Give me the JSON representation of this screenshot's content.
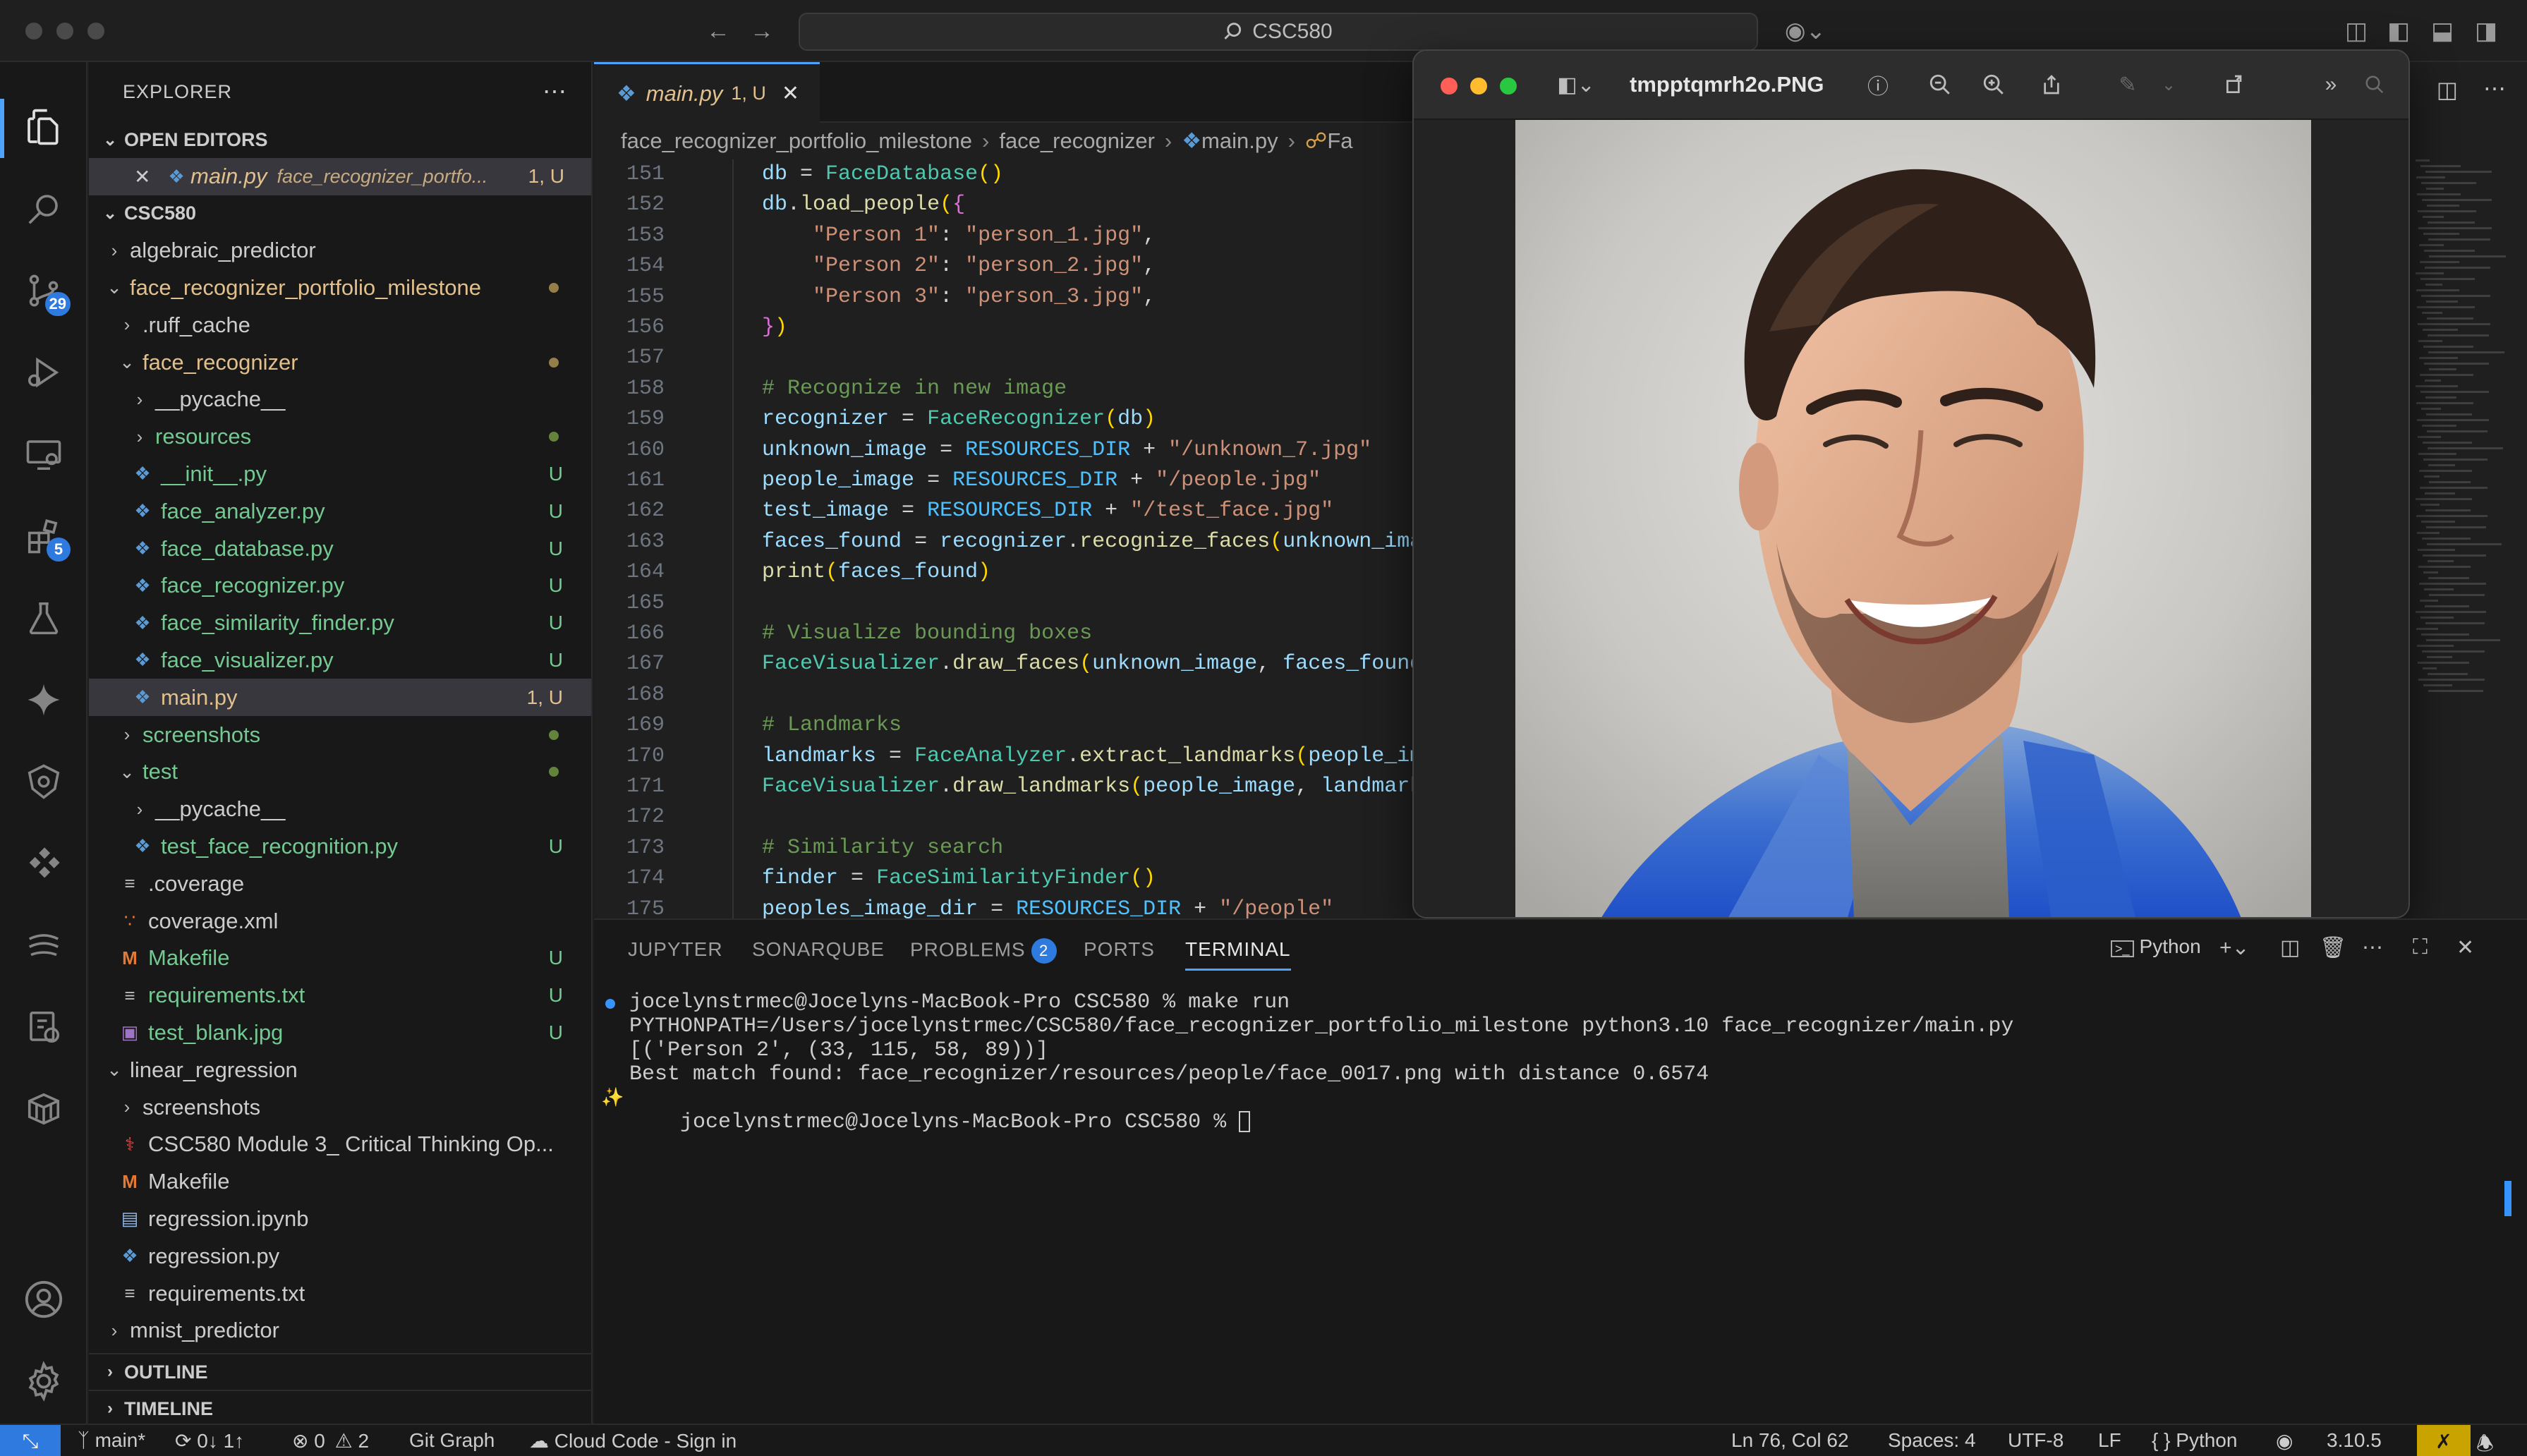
{
  "window": {
    "search_text": "CSC580"
  },
  "activity": {
    "source_control_badge": "29",
    "extensions_badge": "5"
  },
  "explorer": {
    "title": "EXPLORER",
    "open_editors_label": "OPEN EDITORS",
    "open_editor": {
      "name": "main.py",
      "path": "face_recognizer_portfo...",
      "status": "1, U"
    },
    "root_label": "CSC580",
    "tree": [
      {
        "name": "algebraic_predictor",
        "type": "folder",
        "open": false,
        "depth": 0,
        "color": "plain",
        "status": ""
      },
      {
        "name": "face_recognizer_portfolio_milestone",
        "type": "folder",
        "open": true,
        "depth": 0,
        "color": "mod",
        "status": "dot"
      },
      {
        "name": ".ruff_cache",
        "type": "folder",
        "open": false,
        "depth": 1,
        "color": "plain",
        "status": ""
      },
      {
        "name": "face_recognizer",
        "type": "folder",
        "open": true,
        "depth": 1,
        "color": "mod",
        "status": "dot"
      },
      {
        "name": "__pycache__",
        "type": "folder",
        "open": false,
        "depth": 2,
        "color": "plain",
        "status": ""
      },
      {
        "name": "resources",
        "type": "folder",
        "open": false,
        "depth": 2,
        "color": "new",
        "status": "dot"
      },
      {
        "name": "__init__.py",
        "type": "py",
        "depth": 2,
        "color": "new",
        "status": "U"
      },
      {
        "name": "face_analyzer.py",
        "type": "py",
        "depth": 2,
        "color": "new",
        "status": "U"
      },
      {
        "name": "face_database.py",
        "type": "py",
        "depth": 2,
        "color": "new",
        "status": "U"
      },
      {
        "name": "face_recognizer.py",
        "type": "py",
        "depth": 2,
        "color": "new",
        "status": "U"
      },
      {
        "name": "face_similarity_finder.py",
        "type": "py",
        "depth": 2,
        "color": "new",
        "status": "U"
      },
      {
        "name": "face_visualizer.py",
        "type": "py",
        "depth": 2,
        "color": "new",
        "status": "U"
      },
      {
        "name": "main.py",
        "type": "py",
        "depth": 2,
        "color": "mod",
        "status": "1, U",
        "selected": true
      },
      {
        "name": "screenshots",
        "type": "folder",
        "open": false,
        "depth": 1,
        "color": "new",
        "status": "dot"
      },
      {
        "name": "test",
        "type": "folder",
        "open": true,
        "depth": 1,
        "color": "new",
        "status": "dot"
      },
      {
        "name": "__pycache__",
        "type": "folder",
        "open": false,
        "depth": 2,
        "color": "plain",
        "status": ""
      },
      {
        "name": "test_face_recognition.py",
        "type": "py",
        "depth": 2,
        "color": "new",
        "status": "U"
      },
      {
        "name": ".coverage",
        "type": "txt",
        "depth": 1,
        "color": "plain",
        "status": ""
      },
      {
        "name": "coverage.xml",
        "type": "rss",
        "depth": 1,
        "color": "plain",
        "status": ""
      },
      {
        "name": "Makefile",
        "type": "mk",
        "depth": 1,
        "color": "new",
        "status": "U"
      },
      {
        "name": "requirements.txt",
        "type": "txt",
        "depth": 1,
        "color": "new",
        "status": "U"
      },
      {
        "name": "test_blank.jpg",
        "type": "img",
        "depth": 1,
        "color": "new",
        "status": "U"
      },
      {
        "name": "linear_regression",
        "type": "folder",
        "open": true,
        "depth": 0,
        "color": "plain",
        "status": ""
      },
      {
        "name": "screenshots",
        "type": "folder",
        "open": false,
        "depth": 1,
        "color": "plain",
        "status": ""
      },
      {
        "name": "CSC580 Module 3_ Critical Thinking Op...",
        "type": "pdf",
        "depth": 1,
        "color": "plain",
        "status": ""
      },
      {
        "name": "Makefile",
        "type": "mk",
        "depth": 1,
        "color": "plain",
        "status": ""
      },
      {
        "name": "regression.ipynb",
        "type": "nb",
        "depth": 1,
        "color": "plain",
        "status": ""
      },
      {
        "name": "regression.py",
        "type": "py",
        "depth": 1,
        "color": "plain",
        "status": ""
      },
      {
        "name": "requirements.txt",
        "type": "txt",
        "depth": 1,
        "color": "plain",
        "status": ""
      },
      {
        "name": "mnist_predictor",
        "type": "folder",
        "open": false,
        "depth": 0,
        "color": "plain",
        "status": ""
      }
    ],
    "outline_label": "OUTLINE",
    "timeline_label": "TIMELINE"
  },
  "editor": {
    "tab": {
      "name": "main.py",
      "status": "1, U"
    },
    "breadcrumb": [
      "face_recognizer_portfolio_milestone",
      "face_recognizer",
      "main.py",
      "Fa"
    ],
    "lines": [
      {
        "n": "151",
        "t": [
          [
            "    ",
            "op"
          ],
          [
            "db",
            "var"
          ],
          [
            " = ",
            "op"
          ],
          [
            "FaceDatabase",
            "cls"
          ],
          [
            "()",
            "br2"
          ]
        ]
      },
      {
        "n": "152",
        "t": [
          [
            "    ",
            "op"
          ],
          [
            "db",
            "var"
          ],
          [
            ".",
            "op"
          ],
          [
            "load_people",
            "fn"
          ],
          [
            "(",
            "br2"
          ],
          [
            "{",
            "br"
          ]
        ]
      },
      {
        "n": "153",
        "t": [
          [
            "        ",
            "op"
          ],
          [
            "\"Person 1\"",
            "str"
          ],
          [
            ": ",
            "op"
          ],
          [
            "\"person_1.jpg\"",
            "str"
          ],
          [
            ",",
            "op"
          ]
        ]
      },
      {
        "n": "154",
        "t": [
          [
            "        ",
            "op"
          ],
          [
            "\"Person 2\"",
            "str"
          ],
          [
            ": ",
            "op"
          ],
          [
            "\"person_2.jpg\"",
            "str"
          ],
          [
            ",",
            "op"
          ]
        ]
      },
      {
        "n": "155",
        "t": [
          [
            "        ",
            "op"
          ],
          [
            "\"Person 3\"",
            "str"
          ],
          [
            ": ",
            "op"
          ],
          [
            "\"person_3.jpg\"",
            "str"
          ],
          [
            ",",
            "op"
          ]
        ]
      },
      {
        "n": "156",
        "t": [
          [
            "    ",
            "op"
          ],
          [
            "}",
            "br"
          ],
          [
            ")",
            "br2"
          ]
        ]
      },
      {
        "n": "157",
        "t": []
      },
      {
        "n": "158",
        "t": [
          [
            "    ",
            "op"
          ],
          [
            "# Recognize in new image",
            "cm"
          ]
        ]
      },
      {
        "n": "159",
        "t": [
          [
            "    ",
            "op"
          ],
          [
            "recognizer",
            "var"
          ],
          [
            " = ",
            "op"
          ],
          [
            "FaceRecognizer",
            "cls"
          ],
          [
            "(",
            "br2"
          ],
          [
            "db",
            "var"
          ],
          [
            ")",
            "br2"
          ]
        ]
      },
      {
        "n": "160",
        "t": [
          [
            "    ",
            "op"
          ],
          [
            "unknown_image",
            "var"
          ],
          [
            " = ",
            "op"
          ],
          [
            "RESOURCES_DIR",
            "const"
          ],
          [
            " + ",
            "op"
          ],
          [
            "\"/unknown_7.jpg\"",
            "str"
          ]
        ]
      },
      {
        "n": "161",
        "t": [
          [
            "    ",
            "op"
          ],
          [
            "people_image",
            "var"
          ],
          [
            " = ",
            "op"
          ],
          [
            "RESOURCES_DIR",
            "const"
          ],
          [
            " + ",
            "op"
          ],
          [
            "\"/people.jpg\"",
            "str"
          ]
        ]
      },
      {
        "n": "162",
        "t": [
          [
            "    ",
            "op"
          ],
          [
            "test_image",
            "var"
          ],
          [
            " = ",
            "op"
          ],
          [
            "RESOURCES_DIR",
            "const"
          ],
          [
            " + ",
            "op"
          ],
          [
            "\"/test_face.jpg\"",
            "str"
          ]
        ]
      },
      {
        "n": "163",
        "t": [
          [
            "    ",
            "op"
          ],
          [
            "faces_found",
            "var"
          ],
          [
            " = ",
            "op"
          ],
          [
            "recognizer",
            "var"
          ],
          [
            ".",
            "op"
          ],
          [
            "recognize_faces",
            "fn"
          ],
          [
            "(",
            "br2"
          ],
          [
            "unknown_image",
            "var"
          ]
        ]
      },
      {
        "n": "164",
        "t": [
          [
            "    ",
            "op"
          ],
          [
            "print",
            "fn"
          ],
          [
            "(",
            "br2"
          ],
          [
            "faces_found",
            "var"
          ],
          [
            ")",
            "br2"
          ]
        ]
      },
      {
        "n": "165",
        "t": []
      },
      {
        "n": "166",
        "t": [
          [
            "    ",
            "op"
          ],
          [
            "# Visualize bounding boxes",
            "cm"
          ]
        ]
      },
      {
        "n": "167",
        "t": [
          [
            "    ",
            "op"
          ],
          [
            "FaceVisualizer",
            "cls"
          ],
          [
            ".",
            "op"
          ],
          [
            "draw_faces",
            "fn"
          ],
          [
            "(",
            "br2"
          ],
          [
            "unknown_image",
            "var"
          ],
          [
            ", ",
            "op"
          ],
          [
            "faces_found",
            "var"
          ],
          [
            ")",
            "br2"
          ]
        ]
      },
      {
        "n": "168",
        "t": []
      },
      {
        "n": "169",
        "t": [
          [
            "    ",
            "op"
          ],
          [
            "# Landmarks",
            "cm"
          ]
        ]
      },
      {
        "n": "170",
        "t": [
          [
            "    ",
            "op"
          ],
          [
            "landmarks",
            "var"
          ],
          [
            " = ",
            "op"
          ],
          [
            "FaceAnalyzer",
            "cls"
          ],
          [
            ".",
            "op"
          ],
          [
            "extract_landmarks",
            "fn"
          ],
          [
            "(",
            "br2"
          ],
          [
            "people_imag",
            "var"
          ]
        ]
      },
      {
        "n": "171",
        "t": [
          [
            "    ",
            "op"
          ],
          [
            "FaceVisualizer",
            "cls"
          ],
          [
            ".",
            "op"
          ],
          [
            "draw_landmarks",
            "fn"
          ],
          [
            "(",
            "br2"
          ],
          [
            "people_image",
            "var"
          ],
          [
            ", ",
            "op"
          ],
          [
            "landmarks",
            "var"
          ],
          [
            ")",
            "br2"
          ]
        ]
      },
      {
        "n": "172",
        "t": []
      },
      {
        "n": "173",
        "t": [
          [
            "    ",
            "op"
          ],
          [
            "# Similarity search",
            "cm"
          ]
        ]
      },
      {
        "n": "174",
        "t": [
          [
            "    ",
            "op"
          ],
          [
            "finder",
            "var"
          ],
          [
            " = ",
            "op"
          ],
          [
            "FaceSimilarityFinder",
            "cls"
          ],
          [
            "()",
            "br2"
          ]
        ]
      },
      {
        "n": "175",
        "t": [
          [
            "    ",
            "op"
          ],
          [
            "peoples_image_dir",
            "var"
          ],
          [
            " = ",
            "op"
          ],
          [
            "RESOURCES_DIR",
            "const"
          ],
          [
            " + ",
            "op"
          ],
          [
            "\"/people\"",
            "str"
          ]
        ]
      }
    ]
  },
  "preview": {
    "title": "tmpptqmrh2o.PNG"
  },
  "panel": {
    "tabs": [
      "JUPYTER",
      "SONARQUBE",
      "PROBLEMS",
      "PORTS",
      "TERMINAL"
    ],
    "problems_count": "2",
    "terminal_profile": "Python",
    "terminal_lines": [
      "jocelynstrmec@Jocelyns-MacBook-Pro CSC580 % make run",
      "PYTHONPATH=/Users/jocelynstrmec/CSC580/face_recognizer_portfolio_milestone python3.10 face_recognizer/main.py",
      "[('Person 2', (33, 115, 58, 89))]",
      "Best match found: face_recognizer/resources/people/face_0017.png with distance 0.6574",
      "jocelynstrmec@Jocelyns-MacBook-Pro CSC580 % "
    ]
  },
  "status": {
    "branch": "main*",
    "sync": "0↓ 1↑",
    "errors": "0",
    "warnings": "2",
    "git_graph": "Git Graph",
    "cloud_code": "Cloud Code - Sign in",
    "position": "Ln 76, Col 62",
    "spaces": "Spaces: 4",
    "encoding": "UTF-8",
    "eol": "LF",
    "language": "Python",
    "python_version": "3.10.5"
  }
}
